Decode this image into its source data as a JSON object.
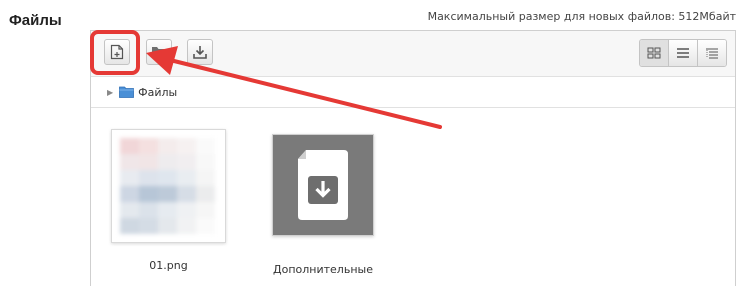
{
  "section": {
    "label": "Файлы"
  },
  "max_size_text": "Максимальный размер для новых файлов: 512Мбайт",
  "toolbar": {
    "add_icon": "add-file-icon",
    "folder_icon": "create-folder-icon",
    "download_icon": "download-icon"
  },
  "views": [
    "icons-view-icon",
    "list-view-icon",
    "tree-view-icon"
  ],
  "path": {
    "folder_label": "Файлы"
  },
  "files": [
    {
      "name": "01.png"
    },
    {
      "name": "Дополнительные"
    }
  ],
  "annotation": {
    "color": "#e53935"
  }
}
